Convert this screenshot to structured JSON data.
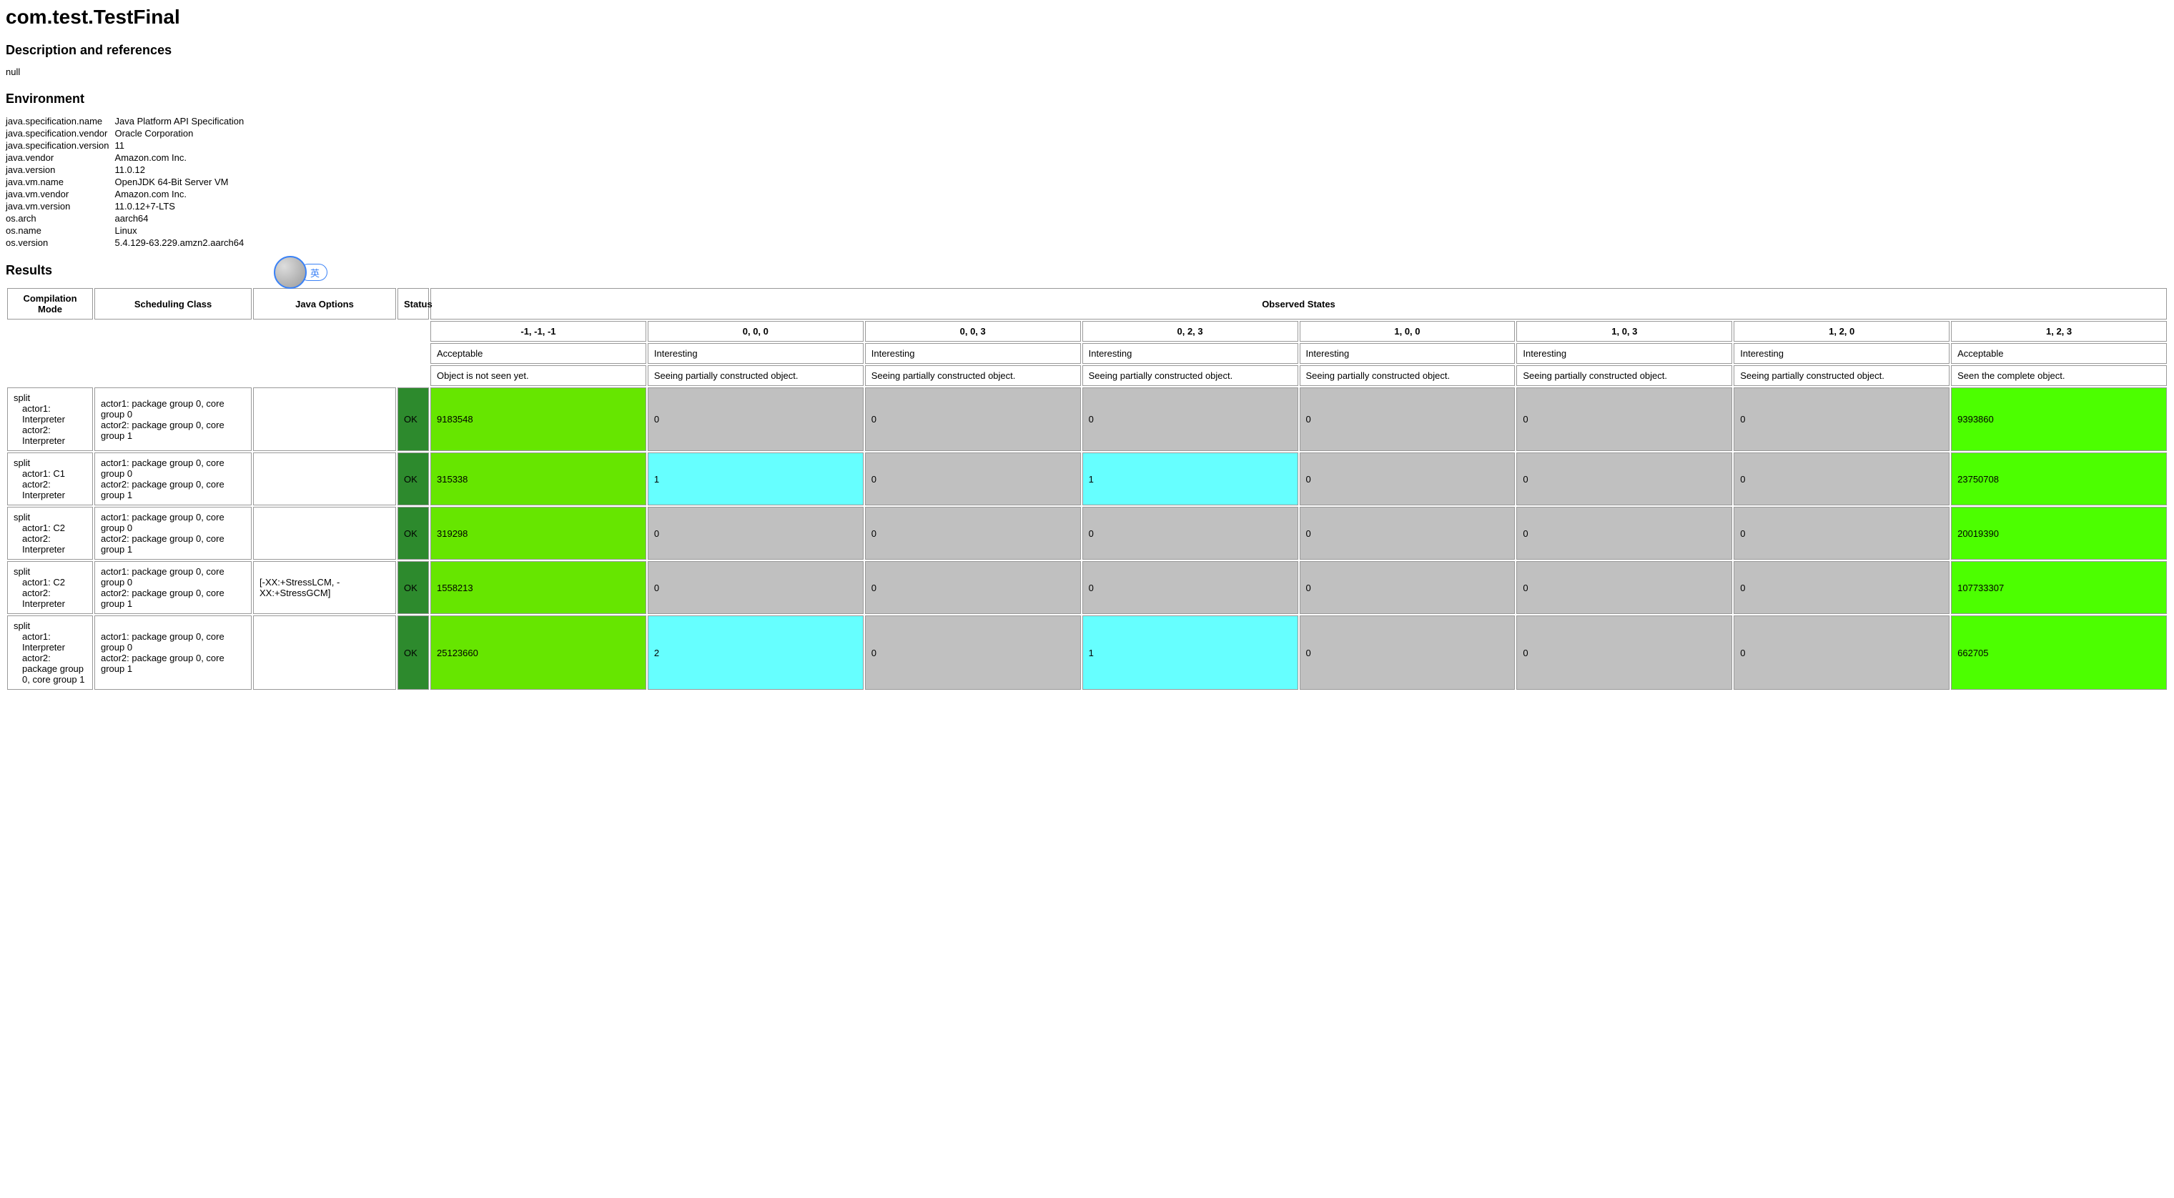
{
  "title": "com.test.TestFinal",
  "sections": {
    "desc_heading": "Description and references",
    "desc_value": "null",
    "env_heading": "Environment",
    "results_heading": "Results"
  },
  "environment": [
    {
      "key": "java.specification.name",
      "value": "Java Platform API Specification"
    },
    {
      "key": "java.specification.vendor",
      "value": "Oracle Corporation"
    },
    {
      "key": "java.specification.version",
      "value": "11"
    },
    {
      "key": "java.vendor",
      "value": "Amazon.com Inc."
    },
    {
      "key": "java.version",
      "value": "11.0.12"
    },
    {
      "key": "java.vm.name",
      "value": "OpenJDK 64-Bit Server VM"
    },
    {
      "key": "java.vm.vendor",
      "value": "Amazon.com Inc."
    },
    {
      "key": "java.vm.version",
      "value": "11.0.12+7-LTS"
    },
    {
      "key": "os.arch",
      "value": "aarch64"
    },
    {
      "key": "os.name",
      "value": "Linux"
    },
    {
      "key": "os.version",
      "value": "5.4.129-63.229.amzn2.aarch64"
    }
  ],
  "results": {
    "headers": {
      "compilation_mode": "Compilation Mode",
      "scheduling_class": "Scheduling Class",
      "java_options": "Java Options",
      "status": "Status",
      "observed_states": "Observed States"
    },
    "states": [
      {
        "label": "-1, -1, -1",
        "interpretation": "Acceptable",
        "description": "Object is not seen yet."
      },
      {
        "label": "0, 0, 0",
        "interpretation": "Interesting",
        "description": "Seeing partially constructed object."
      },
      {
        "label": "0, 0, 3",
        "interpretation": "Interesting",
        "description": "Seeing partially constructed object."
      },
      {
        "label": "0, 2, 3",
        "interpretation": "Interesting",
        "description": "Seeing partially constructed object."
      },
      {
        "label": "1, 0, 0",
        "interpretation": "Interesting",
        "description": "Seeing partially constructed object."
      },
      {
        "label": "1, 0, 3",
        "interpretation": "Interesting",
        "description": "Seeing partially constructed object."
      },
      {
        "label": "1, 2, 0",
        "interpretation": "Interesting",
        "description": "Seeing partially constructed object."
      },
      {
        "label": "1, 2, 3",
        "interpretation": "Acceptable",
        "description": "Seen the complete object."
      }
    ],
    "rows": [
      {
        "mode": {
          "top": "split",
          "line1": "actor1: Interpreter",
          "line2": "actor2: Interpreter"
        },
        "sched": {
          "line1": "actor1: package group 0, core group 0",
          "line2": "actor2: package group 0, core group 1"
        },
        "opts": "",
        "status": "OK",
        "counts": [
          {
            "v": "9183548",
            "c": "green"
          },
          {
            "v": "0",
            "c": "gray"
          },
          {
            "v": "0",
            "c": "gray"
          },
          {
            "v": "0",
            "c": "gray"
          },
          {
            "v": "0",
            "c": "gray"
          },
          {
            "v": "0",
            "c": "gray"
          },
          {
            "v": "0",
            "c": "gray"
          },
          {
            "v": "9393860",
            "c": "brightgreen"
          }
        ]
      },
      {
        "mode": {
          "top": "split",
          "line1": "actor1: C1",
          "line2": "actor2: Interpreter"
        },
        "sched": {
          "line1": "actor1: package group 0, core group 0",
          "line2": "actor2: package group 0, core group 1"
        },
        "opts": "",
        "status": "OK",
        "counts": [
          {
            "v": "315338",
            "c": "green"
          },
          {
            "v": "1",
            "c": "cyan"
          },
          {
            "v": "0",
            "c": "gray"
          },
          {
            "v": "1",
            "c": "cyan"
          },
          {
            "v": "0",
            "c": "gray"
          },
          {
            "v": "0",
            "c": "gray"
          },
          {
            "v": "0",
            "c": "gray"
          },
          {
            "v": "23750708",
            "c": "brightgreen"
          }
        ]
      },
      {
        "mode": {
          "top": "split",
          "line1": "actor1: C2",
          "line2": "actor2: Interpreter"
        },
        "sched": {
          "line1": "actor1: package group 0, core group 0",
          "line2": "actor2: package group 0, core group 1"
        },
        "opts": "",
        "status": "OK",
        "counts": [
          {
            "v": "319298",
            "c": "green"
          },
          {
            "v": "0",
            "c": "gray"
          },
          {
            "v": "0",
            "c": "gray"
          },
          {
            "v": "0",
            "c": "gray"
          },
          {
            "v": "0",
            "c": "gray"
          },
          {
            "v": "0",
            "c": "gray"
          },
          {
            "v": "0",
            "c": "gray"
          },
          {
            "v": "20019390",
            "c": "brightgreen"
          }
        ]
      },
      {
        "mode": {
          "top": "split",
          "line1": "actor1: C2",
          "line2": "actor2: Interpreter"
        },
        "sched": {
          "line1": "actor1: package group 0, core group 0",
          "line2": "actor2: package group 0, core group 1"
        },
        "opts": "[-XX:+StressLCM, -XX:+StressGCM]",
        "status": "OK",
        "counts": [
          {
            "v": "1558213",
            "c": "green"
          },
          {
            "v": "0",
            "c": "gray"
          },
          {
            "v": "0",
            "c": "gray"
          },
          {
            "v": "0",
            "c": "gray"
          },
          {
            "v": "0",
            "c": "gray"
          },
          {
            "v": "0",
            "c": "gray"
          },
          {
            "v": "0",
            "c": "gray"
          },
          {
            "v": "107733307",
            "c": "brightgreen"
          }
        ]
      },
      {
        "mode": {
          "top": "split",
          "line1": "actor1: Interpreter",
          "line2": "actor2: package group 0, core group 1"
        },
        "sched": {
          "line1": "actor1: package group 0, core group 0",
          "line2": "actor2: package group 0, core group 1"
        },
        "opts": "",
        "status": "OK",
        "counts": [
          {
            "v": "25123660",
            "c": "green"
          },
          {
            "v": "2",
            "c": "cyan"
          },
          {
            "v": "0",
            "c": "gray"
          },
          {
            "v": "1",
            "c": "cyan"
          },
          {
            "v": "0",
            "c": "gray"
          },
          {
            "v": "0",
            "c": "gray"
          },
          {
            "v": "0",
            "c": "gray"
          },
          {
            "v": "662705",
            "c": "brightgreen"
          }
        ]
      }
    ]
  },
  "badge": {
    "label": "英"
  }
}
